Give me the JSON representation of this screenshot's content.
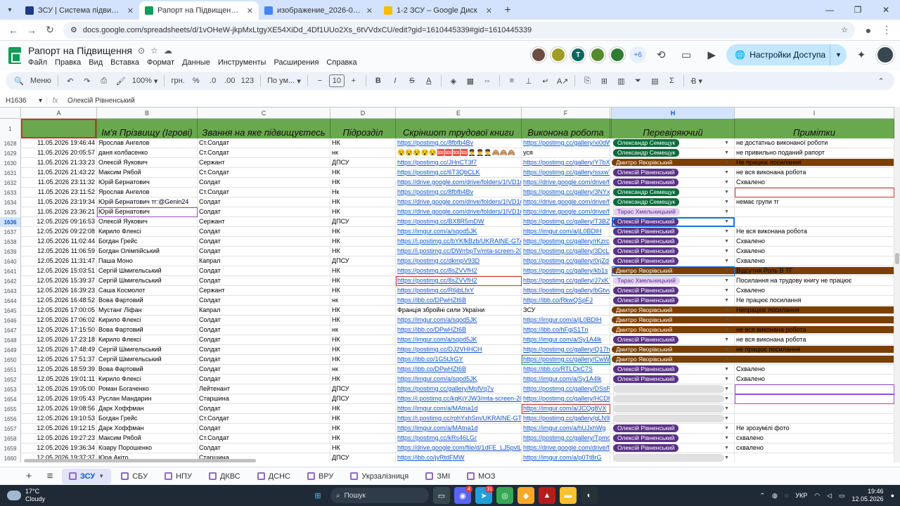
{
  "browser": {
    "tabs": [
      {
        "title": "ЗСУ | Система підвищення та н",
        "color": "#1e3a8a"
      },
      {
        "title": "Рапорт на Підвищення - Goog",
        "color": "#0f9d58"
      },
      {
        "title": "изображение_2026-05-12_193",
        "color": "#4285f4"
      },
      {
        "title": "1-2 ЗСУ – Google Диск",
        "color": "#fbbc04"
      }
    ],
    "url": "docs.google.com/spreadsheets/d/1vOHeW-jkpMxLtgyXE54XiDd_4Df1UUo2Xs_6tVVdxCU/edit?gid=1610445339#gid=1610445339"
  },
  "doc": {
    "title": "Рапорт на Підвищення",
    "menus": [
      "Файл",
      "Правка",
      "Вид",
      "Вставка",
      "Формат",
      "Данные",
      "Инструменты",
      "Расширения",
      "Справка"
    ],
    "avatars": [
      {
        "letter": "",
        "color": "#6d4c41"
      },
      {
        "letter": "",
        "color": "#9e9d24"
      },
      {
        "letter": "T",
        "color": "#00695c"
      },
      {
        "letter": "",
        "color": "#558b2f"
      },
      {
        "letter": "",
        "color": "#2e7d32"
      }
    ],
    "more_collaborators": "+6",
    "share_label": "Настройки Доступа"
  },
  "toolbar": {
    "menu_label": "Меню",
    "zoom": "100%",
    "currency": "грн.",
    "percent": "%",
    "dec_dec": ".0",
    "dec_inc": ".00",
    "num_fmt": "123",
    "font": "По ум...",
    "font_size": "10"
  },
  "formula_bar": {
    "cell_ref": "H1636",
    "value": "Олексій Рівненський"
  },
  "columns": [
    {
      "letter": "",
      "header": ""
    },
    {
      "letter": "A",
      "header": ""
    },
    {
      "letter": "B",
      "header": "Ім'я Прізвищу (Ігрові)"
    },
    {
      "letter": "C",
      "header": "Звання на яке підвищуєтесь"
    },
    {
      "letter": "D",
      "header": "Підрозділ"
    },
    {
      "letter": "E",
      "header": "Скріншот трудової книги"
    },
    {
      "letter": "F",
      "header": "Виконона робота"
    },
    {
      "letter": "",
      "header": ""
    },
    {
      "letter": "H",
      "header": "Перевіряючий"
    },
    {
      "letter": "I",
      "header": "Примітки"
    }
  ],
  "rows": [
    {
      "n": "1628",
      "a": "11.05.2026 19:46:44",
      "b": "Ярослав Ангелов",
      "c": "Ст.Солдат",
      "d": "НК",
      "e": "https://postimg.cc/8fbfb4Bv",
      "f": "https://postimg.cc/gallery/xi0dW",
      "h": "Олександр Семещук",
      "hk": "y",
      "i": "не достатньо виконаної роботи"
    },
    {
      "n": "1629",
      "a": "11.05.2026 20:05:57",
      "b": "даня колбасенко",
      "c": "Ст.Солдат",
      "d": "нк",
      "e": "😵😵😵😵😵🆘🆘🆘🆘👨‍✈️👨‍✈️👨‍✈️🙈🙈🙈",
      "el": false,
      "f": "уся",
      "fl": false,
      "h": "Олександр Семещук",
      "hk": "y",
      "i": "не привильно поданий рапорт"
    },
    {
      "n": "1630",
      "a": "11.05.2026 21:33:23",
      "b": "Олексій Яукович",
      "c": "Сержант",
      "d": "ДПСУ",
      "e": "https://postimg.cc/JHnCT3f7",
      "f": "https://postimg.cc/gallery/Y7bX",
      "h": "Дмитро Яворівський",
      "hk": "r",
      "i": "Не працює посилання"
    },
    {
      "n": "1631",
      "a": "11.05.2026 21:43:22",
      "b": "Максим Рябой",
      "c": "Ст.Солдат",
      "d": "НК",
      "e": "https://postimg.cc/6T3QbCLK",
      "f": "https://postimg.cc/gallery/ssxwT",
      "h": "Олексій Рівненський",
      "hk": "o",
      "i": "не вся виконана робота"
    },
    {
      "n": "1632",
      "a": "11.05.2026 23:11:32",
      "b": "Юрій Бернатович",
      "c": "Солдат",
      "d": "НК",
      "e": "https://drive.google.com/drive/folders/1IVD1u",
      "f": "https://drive.google.com/drive/fo",
      "h": "Олексій Рівненський",
      "hk": "o",
      "i": "Схвалено"
    },
    {
      "n": "1633",
      "a": "11.05.2026 23:11:52",
      "b": "Ярослав Ангелов",
      "c": "Ст.Солдат",
      "d": "Нк",
      "e": "https://postimg.cc/8fbfb4Bv",
      "f": "https://postimg.cc/gallery/3NYx",
      "h": "Олександр Семещук",
      "hk": "y",
      "i": ""
    },
    {
      "n": "1634",
      "a": "11.05.2026 23:19:34",
      "b": "Юрій Бернатович тг:@Genin24",
      "c": "Солдат",
      "d": "НК",
      "e": "https://drive.google.com/drive/folders/1IVD1u",
      "f": "https://drive.google.com/drive/fo",
      "h": "Олександр Семещук",
      "hk": "y",
      "i": "немає групи тг"
    },
    {
      "n": "1635",
      "a": "11.05.2026 23:36:21",
      "b": "Юрій Бернатович",
      "c": "Солдат",
      "d": "НК",
      "e": "https://drive.google.com/drive/folders/1IVD1u",
      "f": "https://drive.google.com/drive/fo",
      "h": "Тарас Хмельницький",
      "hk": "t",
      "i": ""
    },
    {
      "n": "1636",
      "a": "12.05.2026 09:16:53",
      "b": "Олексій Яукович",
      "c": "Сержант",
      "d": "ДПСУ",
      "e": "https://postimg.cc/BX8R5mDW",
      "f": "https://postimg.cc/gallery/T3BZ",
      "h": "Олексій Рівненський",
      "hk": "o",
      "i": ""
    },
    {
      "n": "1637",
      "a": "12.05.2026 09:22:08",
      "b": "Кирило Флексі",
      "c": "Солдат",
      "d": "НК",
      "e": "https://imgur.com/a/sqod5JK",
      "f": "https://imgur.com/a/jL0BDlH",
      "h": "Олексій Рівненський",
      "hk": "o",
      "i": "Не вся виконана робота"
    },
    {
      "n": "1638",
      "a": "12.05.2026 11:02:44",
      "b": "Богдан Грейс",
      "c": "Солдат",
      "d": "НК",
      "e": "https://i.postimg.cc/bYKfkBzb/UKRAINE-GTA",
      "f": "https://postimg.cc/gallery/rKzrc",
      "h": "Олексій Рівненський",
      "hk": "o",
      "i": "Схвалено"
    },
    {
      "n": "1639",
      "a": "12.05.2026 11:06:59",
      "b": "Богдан Олімпійський",
      "c": "Солдат",
      "d": "НК",
      "e": "https://i.postimg.cc/DWrrbpTv/mta-screen-20",
      "f": "https://postimg.cc/gallery/3DcL",
      "h": "Олексій Рівненський",
      "hk": "o",
      "i": "Схвалено"
    },
    {
      "n": "1640",
      "a": "12.05.2026 11:31:47",
      "b": "Паша Моно",
      "c": "Капрал",
      "d": "ДПСУ",
      "e": "https://postimg.cc/dkmpV93D",
      "f": "https://postimg.cc/gallery/0rjZd",
      "h": "Олексій Рівненський",
      "hk": "o",
      "i": "Схвалено"
    },
    {
      "n": "1641",
      "a": "12.05.2026 15:03:51",
      "b": "Сергій Шмигельський",
      "c": "Солдат",
      "d": "НК",
      "e": "https://postimg.cc/8sZVVfH2",
      "f": "https://postimg.cc/gallery/kb1s",
      "h": "Дмитро Яворівський",
      "hk": "r",
      "i": "Відсутня Роль В ТГ"
    },
    {
      "n": "1642",
      "a": "12.05.2026 15:39:37",
      "b": "Сергій Шмигельський",
      "c": "Солдат",
      "d": "НК",
      "e": "https://postimg.cc/8sZVVfH2",
      "f": "https://postimg.cc/gallery/J7xK7",
      "h": "Тарас Хмельницький",
      "hk": "t",
      "i": "Посилання на трудову книгу не працює"
    },
    {
      "n": "1643",
      "a": "12.05.2026 16:39:23",
      "b": "Саша Космолот",
      "c": "Сержант",
      "d": "НК",
      "e": "https://postimg.cc/R6jbLfxY",
      "f": "https://postimg.cc/gallery/bGtvv",
      "h": "Олексій Рівненський",
      "hk": "o",
      "i": "Схвалено"
    },
    {
      "n": "1644",
      "a": "12.05.2026 16:48:52",
      "b": "Вова Фартовий",
      "c": "Солдат",
      "d": "нк",
      "e": "https://ibb.co/DPwHZt6B",
      "f": "https://ibb.co/RkwQSpFJ",
      "h": "Олексій Рівненський",
      "hk": "o",
      "i": "Не працює посилання"
    },
    {
      "n": "1645",
      "a": "12.05.2026 17:00:05",
      "b": "Мустанг Ліфан",
      "c": "Капрал",
      "d": "НК",
      "e": "Франція збройні сили України",
      "el": false,
      "f": "ЗСУ",
      "fl": false,
      "h": "Дмитро Яворівський",
      "hk": "r",
      "i": "Непрацює посилання"
    },
    {
      "n": "1646",
      "a": "12.05.2026 17:06:02",
      "b": "Кирило Флексі",
      "c": "Солдат",
      "d": "НК",
      "e": "https://imgur.com/a/sqod5JK",
      "f": "https://imgur.com/a/jL0BDlH",
      "h": "Дмитро Яворівський",
      "hk": "r",
      "i": ""
    },
    {
      "n": "1647",
      "a": "12.05.2026 17:15:50",
      "b": "Вова Фартовий",
      "c": "Солдат",
      "d": "нк",
      "e": "https://ibb.co/DPwHZt6B",
      "f": "https://ibb.co/hFgjS1Tn",
      "h": "Дмитро Яворівський",
      "hk": "r",
      "i": "не вся виконана робота"
    },
    {
      "n": "1648",
      "a": "12.05.2026 17:23:18",
      "b": "Кирило Флексі",
      "c": "Солдат",
      "d": "НК",
      "e": "https://imgur.com/a/sqod5JK",
      "f": "https://imgur.com/a/Sy1A4lk",
      "h": "Олексій Рівненський",
      "hk": "o",
      "i": "не вся виконана робота"
    },
    {
      "n": "1649",
      "a": "12.05.2026 17:48:49",
      "b": "Сергій Шмигельський",
      "c": "Солдат",
      "d": "НК",
      "e": "https://postimg.cc/DJ2VHHCH",
      "f": "https://postimg.cc/gallery/Q17h",
      "h": "Дмитро Яворівський",
      "hk": "r",
      "i": "не працює посилання"
    },
    {
      "n": "1650",
      "a": "12.05.2026 17:51:37",
      "b": "Сергій Шмигельський",
      "c": "Солдат",
      "d": "НК",
      "e": "https://ibb.co/1G5tJrGY",
      "f": "https://postimg.cc/gallery/CwW",
      "h": "Дмитро Яворівський",
      "hk": "r",
      "i": ""
    },
    {
      "n": "1651",
      "a": "12.05.2026 18:59:39",
      "b": "Вова Фартовий",
      "c": "Солдат",
      "d": "нк",
      "e": "https://ibb.co/DPwHZt6B",
      "f": "https://ibb.co/RTLCkC7S",
      "h": "Олексій Рівненський",
      "hk": "o",
      "i": "Схвалено"
    },
    {
      "n": "1652",
      "a": "12.05.2026 19:01:11",
      "b": "Кирило Флексі",
      "c": "Солдат",
      "d": "НК",
      "e": "https://imgur.com/a/sqod5JK",
      "f": "https://imgur.com/a/Sy1A4lk",
      "h": "Олексій Рівненський",
      "hk": "o",
      "i": "Схвалено"
    },
    {
      "n": "1653",
      "a": "12.05.2026 19:05:00",
      "b": "Роман Богаченко",
      "c": "Лейтенант",
      "d": "ДПСУ",
      "e": "https://postimg.cc/gallery/MpfVq7v",
      "f": "https://postimg.cc/gallery/DSsR",
      "h": "",
      "hk": "e",
      "i": ""
    },
    {
      "n": "1654",
      "a": "12.05.2026 19:05:43",
      "b": "Руслан Мандарин",
      "c": "Старшина",
      "d": "ДПСУ",
      "e": "https://i.postimg.cc/kgKjYJW3/mta-screen-20",
      "f": "https://postimg.cc/gallery/HCDh",
      "h": "",
      "hk": "e",
      "i": ""
    },
    {
      "n": "1655",
      "a": "12.05.2026 19:08:56",
      "b": "Дарк Хоффман",
      "c": "Солдат",
      "d": "НК",
      "e": "https://imgur.com/a/MAtna1d",
      "f": "https://imgur.com/a/JCQq8VX",
      "h": "",
      "hk": "e",
      "i": ""
    },
    {
      "n": "1656",
      "a": "12.05.2026 19:10:53",
      "b": "Богдан Грейс",
      "c": "Ст.Солдат",
      "d": "НК",
      "e": "https://i.postimg.cc/rphYxhSm/UKRAINE-GTA",
      "f": "https://postimg.cc/gallery/gLN9",
      "h": "",
      "hk": "e",
      "i": ""
    },
    {
      "n": "1657",
      "a": "12.05.2026 19:12:15",
      "b": "Дарк Хоффман",
      "c": "Солдат",
      "d": "НК",
      "e": "https://imgur.com/a/MAtna1d",
      "f": "https://imgur.com/a/hUJxhWg",
      "h": "Олексій Рівненський",
      "hk": "o",
      "i": "Не зрозумілі фото"
    },
    {
      "n": "1658",
      "a": "12.05.2026 19:27:23",
      "b": "Максим Рябой",
      "c": "Ст.Солдат",
      "d": "НК",
      "e": "https://postimg.cc/kRs46LGr",
      "f": "https://postimg.cc/gallery/Tpmd",
      "h": "Олексій Рівненський",
      "hk": "o",
      "i": "схвалено"
    },
    {
      "n": "1659",
      "a": "12.05.2026 19:36:34",
      "b": "Кізару Порошенко",
      "c": "Солдат",
      "d": "НК",
      "e": "https://drive.google.com/file/d/1dFE_LJ5pvlL",
      "f": "https://drive.google.com/drive/fo",
      "h": "Олексій Рівненський",
      "hk": "o",
      "i": "схвалено"
    },
    {
      "n": "1660",
      "a": "12.05.2026 19:37:37",
      "b": "Юра Акіто",
      "c": "Старшина",
      "d": "ДПСУ",
      "e": "https://ibb.co/jyRtdFMW",
      "f": "https://imgur.com/a/p0Tt8rG",
      "h": "",
      "hk": "e",
      "i": ""
    }
  ],
  "sheet_tabs": [
    "ЗСУ",
    "СБУ",
    "НПУ",
    "ДКВС",
    "ДСНС",
    "ВРУ",
    "Укрзалізниця",
    "ЗМІ",
    "МОЗ"
  ],
  "taskbar": {
    "temp": "17°C",
    "weather": "Cloudy",
    "search_label": "Пошук",
    "lang": "УКР",
    "time": "19:46",
    "date": "12.05.2026",
    "badge_discord": "4",
    "badge_app": "31"
  }
}
